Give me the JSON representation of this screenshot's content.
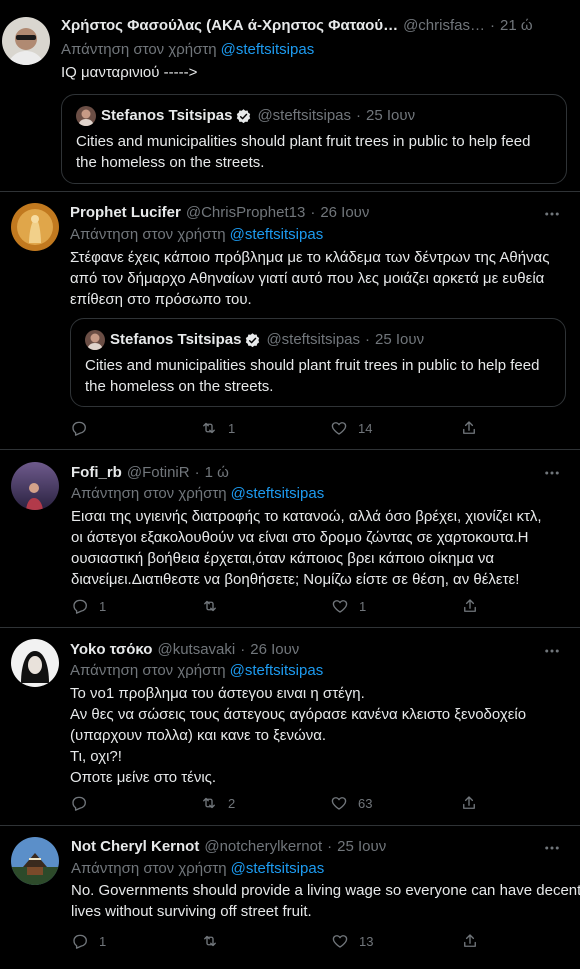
{
  "reply_prefix": "Απάντηση στον χρήστη",
  "icons": {
    "more": "more-dots-icon",
    "reply": "reply-icon",
    "retweet": "retweet-icon",
    "like": "like-icon",
    "share": "share-icon",
    "verified": "verified-badge-icon"
  },
  "tweets": [
    {
      "name": "Χρήστος Φασούλας (ΑΚΑ ά-Χρηστος Φαταού…",
      "handle": "@chrisfas…",
      "dot": "·",
      "time": "21 ώ",
      "reply_to": "@steftsitsipas",
      "lines": [
        "IQ μανταρινιού ----->"
      ],
      "quote": {
        "name": "Stefanos Tsitsipas",
        "handle": "@steftsitsipas",
        "dot": "·",
        "time": "25 Ιουν",
        "lines": [
          "Cities and municipalities should plant fruit trees in public to help feed",
          "the homeless on the streets."
        ]
      }
    },
    {
      "name": "Prophet Lucifer",
      "handle": "@ChrisProphet13",
      "dot": "·",
      "time": "26 Ιουν",
      "reply_to": "@steftsitsipas",
      "lines": [
        "Στέφανε έχεις κάποιο πρόβλημα με το κλάδεμα των δέντρων της Αθήνας",
        "από τον δήμαρχο Αθηναίων γιατί αυτό που λες μοιάζει αρκετά με ευθεία",
        "επίθεση στο πρόσωπο του."
      ],
      "quote": {
        "name": "Stefanos Tsitsipas",
        "handle": "@steftsitsipas",
        "dot": "·",
        "time": "25 Ιουν",
        "lines": [
          "Cities and municipalities should plant fruit trees in public to help feed",
          "the homeless on the streets."
        ]
      },
      "stats": {
        "replies": "",
        "retweets": "1",
        "likes": "14"
      }
    },
    {
      "name": "Fofi_rb",
      "handle": "@FotiniR",
      "dot": "·",
      "time": "1 ώ",
      "reply_to": "@steftsitsipas",
      "lines": [
        "Εισαι της υγιεινής διατροφής το κατανοώ, αλλά όσο βρέχει, χιονίζει κτλ,",
        "οι άστεγοι εξακολουθούν να είναι στο δρομο ζώντας σε χαρτοκουτα.Η",
        "ουσιαστική βοήθεια έρχεται,όταν κάποιος βρει κάποιο οίκημα να",
        "διανείμει.Διατιθεστε να βοηθήσετε; Νομίζω είστε σε θέση, αν θέλετε!"
      ],
      "stats": {
        "replies": "1",
        "retweets": "",
        "likes": "1"
      }
    },
    {
      "name": "Yoko τσόκο",
      "handle": "@kutsavaki",
      "dot": "·",
      "time": "26 Ιουν",
      "reply_to": "@steftsitsipas",
      "lines": [
        "Το νο1 προβλημα του άστεγου ειναι η στέγη.",
        "Αν θες να σώσεις τους άστεγους αγόρασε κανένα κλειστο ξενοδοχείο",
        "(υπαρχουν πολλα) και κανε το ξενώνα.",
        "Τι, οχι?!",
        "Οποτε μείνε στο τένις."
      ],
      "stats": {
        "replies": "",
        "retweets": "2",
        "likes": "63"
      }
    },
    {
      "name": "Not Cheryl Kernot",
      "handle": "@notcherylkernot",
      "dot": "·",
      "time": "25 Ιουν",
      "reply_to": "@steftsitsipas",
      "lines": [
        "No. Governments should provide a living wage so everyone can have decent",
        "lives without surviving off street fruit."
      ],
      "stats": {
        "replies": "1",
        "retweets": "",
        "likes": "13"
      }
    }
  ]
}
